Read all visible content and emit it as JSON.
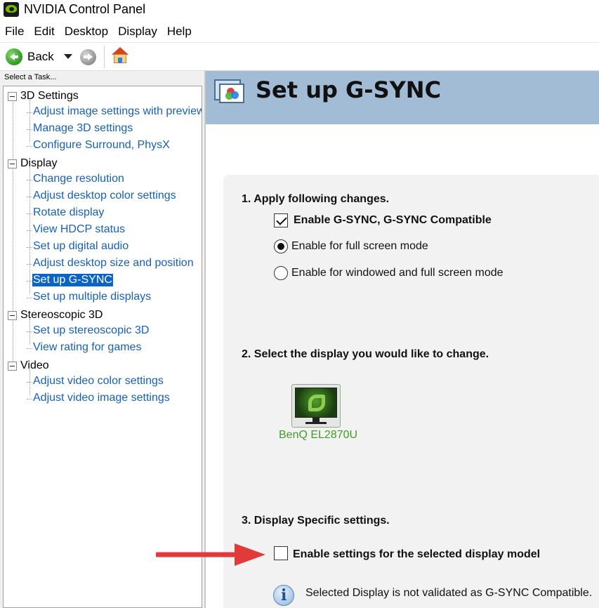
{
  "window": {
    "title": "NVIDIA Control Panel"
  },
  "menu": [
    "File",
    "Edit",
    "Desktop",
    "Display",
    "Help"
  ],
  "toolbar": {
    "back_label": "Back"
  },
  "task_pane": {
    "header": "Select a Task...",
    "categories": [
      {
        "label": "3D Settings",
        "items": [
          "Adjust image settings with preview",
          "Manage 3D settings",
          "Configure Surround, PhysX"
        ]
      },
      {
        "label": "Display",
        "items": [
          "Change resolution",
          "Adjust desktop color settings",
          "Rotate display",
          "View HDCP status",
          "Set up digital audio",
          "Adjust desktop size and position",
          "Set up G-SYNC",
          "Set up multiple displays"
        ]
      },
      {
        "label": "Stereoscopic 3D",
        "items": [
          "Set up stereoscopic 3D",
          "View rating for games"
        ]
      },
      {
        "label": "Video",
        "items": [
          "Adjust video color settings",
          "Adjust video image settings"
        ]
      }
    ],
    "selected_item": "Set up G-SYNC"
  },
  "page": {
    "title": "Set up G-SYNC",
    "section1": {
      "heading": "1. Apply following changes.",
      "enable_checkbox_label": "Enable G-SYNC, G-SYNC Compatible",
      "enable_checked": true,
      "radio_options": [
        "Enable for full screen mode",
        "Enable for windowed and full screen mode"
      ],
      "selected_radio": "Enable for full screen mode"
    },
    "section2": {
      "heading": "2. Select the display you would like to change.",
      "display_name": "BenQ EL2870U"
    },
    "section3": {
      "heading": "3. Display Specific settings.",
      "checkbox_label": "Enable settings for the selected display model",
      "checked": false,
      "info_text": "Selected Display is not validated as G-SYNC Compatible."
    }
  },
  "colors": {
    "header_band": "#a3bcd6",
    "link_blue": "#1660b8",
    "selection": "#0a64c8",
    "display_green": "#3e9d23",
    "annotation_arrow": "#e03a3a"
  }
}
